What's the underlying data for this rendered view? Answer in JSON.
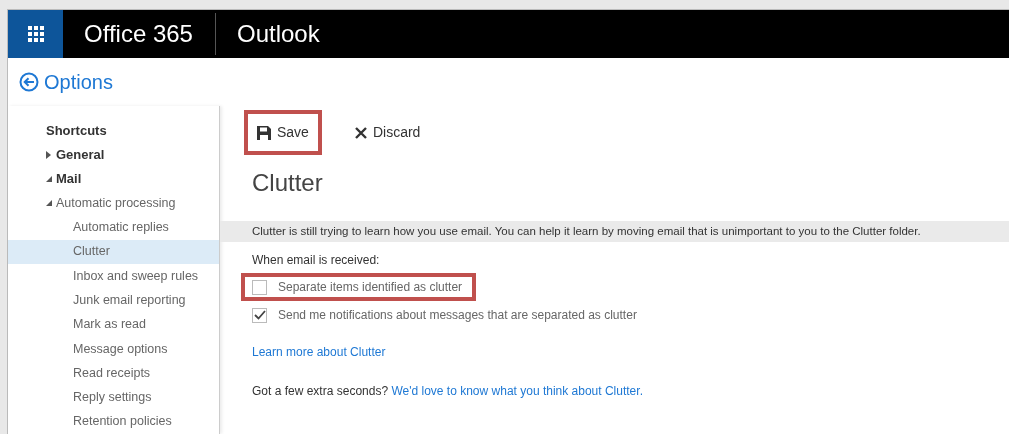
{
  "header": {
    "suite": "Office 365",
    "app": "Outlook"
  },
  "back": {
    "label": "Options"
  },
  "sidebar": {
    "items": [
      {
        "label": "Shortcuts",
        "selected": false
      },
      {
        "label": "General",
        "expanded": false,
        "selected": false
      },
      {
        "label": "Mail",
        "expanded": true,
        "selected": false,
        "children": [
          {
            "label": "Automatic processing",
            "expanded": true,
            "selected": false,
            "children": [
              {
                "label": "Automatic replies",
                "selected": false
              },
              {
                "label": "Clutter",
                "selected": true
              },
              {
                "label": "Inbox and sweep rules",
                "selected": false
              },
              {
                "label": "Junk email reporting",
                "selected": false
              },
              {
                "label": "Mark as read",
                "selected": false
              },
              {
                "label": "Message options",
                "selected": false
              },
              {
                "label": "Read receipts",
                "selected": false
              },
              {
                "label": "Reply settings",
                "selected": false
              },
              {
                "label": "Retention policies",
                "selected": false
              }
            ]
          }
        ]
      }
    ]
  },
  "toolbar": [
    {
      "kind": "save",
      "label": "Save",
      "highlighted": true
    },
    {
      "kind": "discard",
      "label": "Discard",
      "highlighted": false
    }
  ],
  "heading": "Clutter",
  "info": "Clutter is still trying to learn how you use email. You can help it learn by moving email that is unimportant to you to the Clutter folder.",
  "section_label": "When email is received:",
  "options": [
    {
      "label": "Separate items identified as clutter",
      "checked": false,
      "highlighted": true
    },
    {
      "label": "Send me notifications about messages that are separated as clutter",
      "checked": true,
      "highlighted": false
    }
  ],
  "learn_link": "Learn more about Clutter",
  "feedback": {
    "text": "Got a few extra seconds?",
    "link": "We'd love to know what you think about Clutter."
  }
}
